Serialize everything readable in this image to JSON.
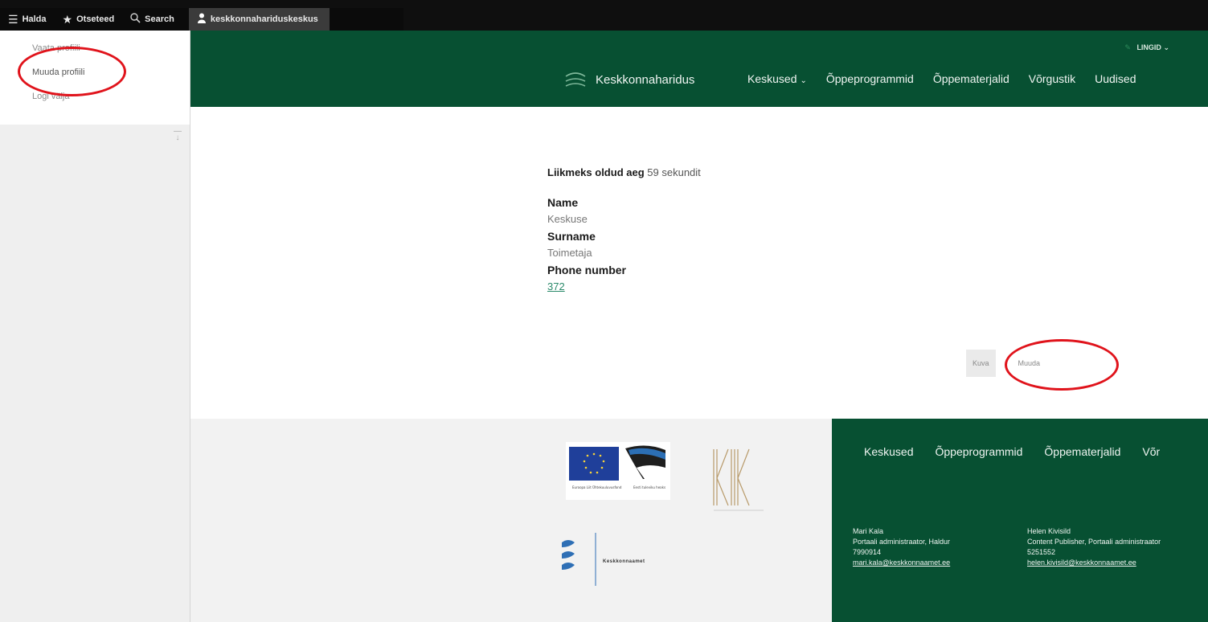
{
  "toolbar": {
    "manage_label": "Halda",
    "shortcuts_label": "Otseteed",
    "search_label": "Search",
    "user_label": "keskkonnahariduskeskus"
  },
  "tray": {
    "items": [
      {
        "label": "Vaata profiili"
      },
      {
        "label": "Muuda profiili"
      },
      {
        "label": "Logi välja"
      }
    ]
  },
  "header": {
    "language": "LINGID",
    "site_name": "Keskkonnaharidus",
    "nav": [
      {
        "label": "Keskused",
        "has_dropdown": true
      },
      {
        "label": "Õppeprogrammid"
      },
      {
        "label": "Õppematerjalid"
      },
      {
        "label": "Võrgustik"
      },
      {
        "label": "Uudised"
      }
    ]
  },
  "profile": {
    "member_for_label": "Liikmeks oldud aeg",
    "member_for_value": "59 sekundit",
    "fields": [
      {
        "label": "Name",
        "value": "Keskuse"
      },
      {
        "label": "Surname",
        "value": "Toimetaja"
      },
      {
        "label": "Phone number",
        "value": "372"
      }
    ]
  },
  "tabs": {
    "view_label": "Kuva",
    "edit_label": "Muuda"
  },
  "footer": {
    "nav": [
      {
        "label": "Keskused"
      },
      {
        "label": "Õppeprogrammid"
      },
      {
        "label": "Õppematerjalid"
      },
      {
        "label": "Võr"
      }
    ],
    "eu_caption": "Euroopa Liit Ühtekuuluvusfond",
    "eesti_caption": "Eesti tuleviku heaks",
    "keskkonnaamet_label": "Keskkonnaamet",
    "contacts": [
      {
        "name": "Mari Kala",
        "role": "Portaali administraator, Haldur",
        "phone": "7990914",
        "email": "mari.kala@keskkonnaamet.ee"
      },
      {
        "name": "Helen Kivisild",
        "role": "Content Publisher, Portaali administraator",
        "phone": "5251552",
        "email": "helen.kivisild@keskkonnaamet.ee"
      }
    ]
  },
  "colors": {
    "brand_green": "#075032",
    "annotation_red": "#e0131b",
    "link_green": "#2b8a6b"
  },
  "icons": [
    "menu-icon",
    "star-icon",
    "search-icon",
    "user-icon",
    "pencil-icon",
    "logo-waves-icon"
  ]
}
